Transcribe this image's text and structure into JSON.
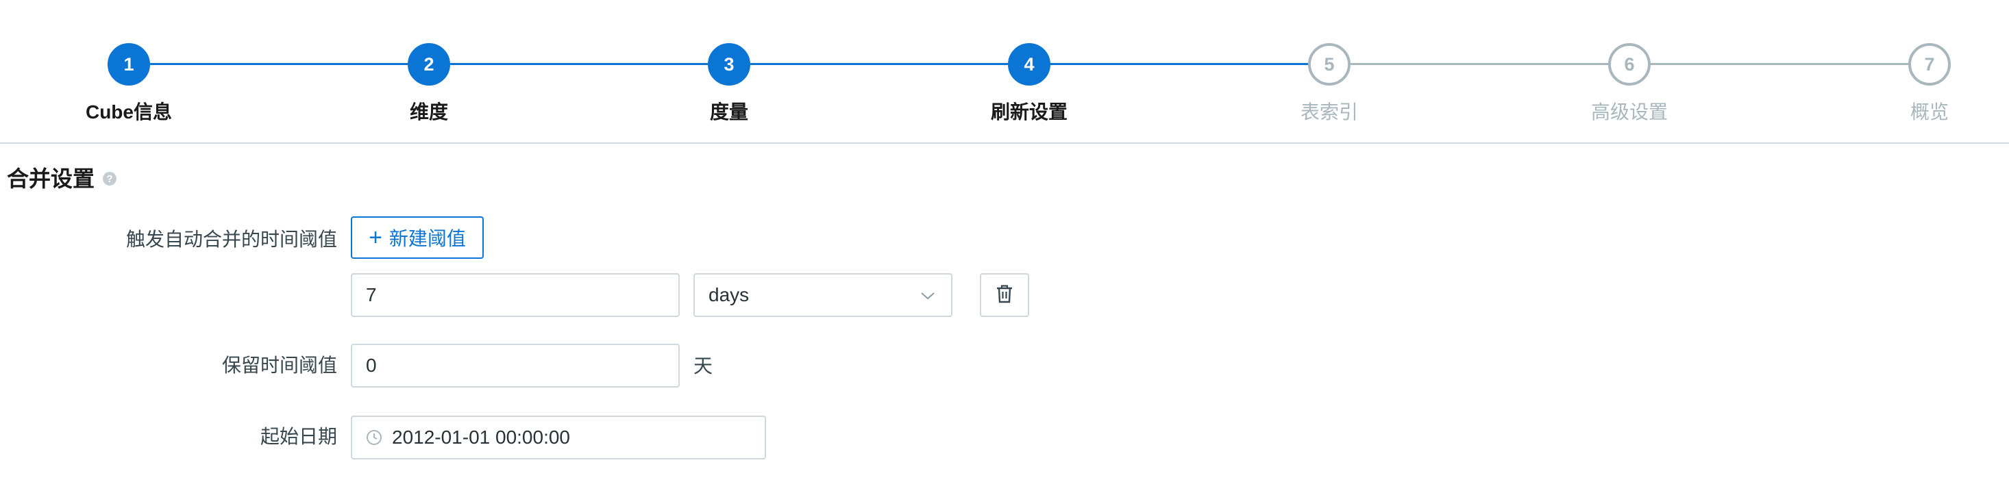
{
  "stepper": {
    "steps": [
      {
        "number": "1",
        "label": "Cube信息",
        "state": "done"
      },
      {
        "number": "2",
        "label": "维度",
        "state": "done"
      },
      {
        "number": "3",
        "label": "度量",
        "state": "done"
      },
      {
        "number": "4",
        "label": "刷新设置",
        "state": "done"
      },
      {
        "number": "5",
        "label": "表索引",
        "state": "todo"
      },
      {
        "number": "6",
        "label": "高级设置",
        "state": "todo"
      },
      {
        "number": "7",
        "label": "概览",
        "state": "todo"
      }
    ],
    "colors": {
      "done": "#0a75d4",
      "todo": "#a8b6be"
    }
  },
  "section": {
    "title": "合并设置",
    "help_icon": "question-circle-icon",
    "help_glyph": "?"
  },
  "form": {
    "merge_threshold": {
      "label": "触发自动合并的时间阈值",
      "add_button": "新建阈值",
      "add_icon": "plus-icon",
      "add_glyph": "+",
      "value": "7",
      "unit": "days",
      "delete_icon": "trash-icon"
    },
    "retention": {
      "label": "保留时间阈值",
      "value": "0",
      "unit": "天"
    },
    "start_date": {
      "label": "起始日期",
      "value": "2012-01-01 00:00:00",
      "icon": "clock-icon"
    }
  }
}
